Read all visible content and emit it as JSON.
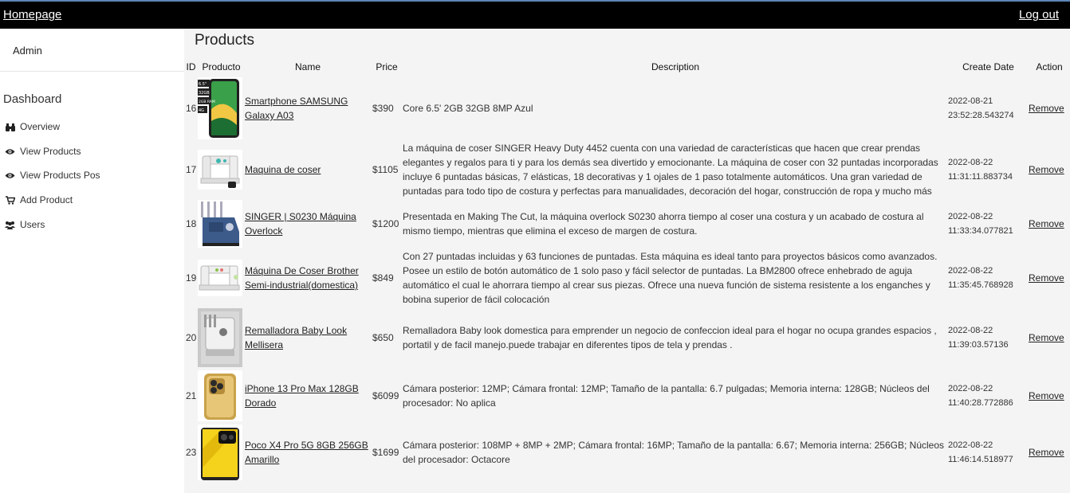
{
  "topbar": {
    "home": "Homepage",
    "logout": "Log out"
  },
  "sidebar": {
    "user": "Admin",
    "section": "Dashboard",
    "items": [
      {
        "label": "Overview",
        "icon": "binoculars-icon"
      },
      {
        "label": "View Products",
        "icon": "eye-icon"
      },
      {
        "label": "View Products Pos",
        "icon": "eye-icon"
      },
      {
        "label": "Add Product",
        "icon": "cart-icon"
      },
      {
        "label": "Users",
        "icon": "users-icon"
      }
    ]
  },
  "main": {
    "title": "Products",
    "columns": [
      "ID",
      "Producto",
      "Name",
      "Price",
      "Description",
      "Create Date",
      "Action"
    ],
    "rows": [
      {
        "id": "16",
        "name": "Smartphone SAMSUNG Galaxy A03",
        "price": "$390",
        "description": "Core 6.5' 2GB 32GB 8MP Azul",
        "date": "2022-08-21 23:52:28.543274",
        "action": "Remove",
        "image": "phone-samsung"
      },
      {
        "id": "17",
        "name": "Maquina de coser",
        "price": "$1105",
        "description": "La máquina de coser SINGER Heavy Duty 4452 cuenta con una variedad de características que hacen que crear prendas elegantes y regalos para ti y para los demás sea divertido y emocionante. La máquina de coser con 32 puntadas incorporadas incluye 6 puntadas básicas, 7 elásticas, 18 decorativas y 1 ojales de 1 paso totalmente automáticos. Una gran variedad de puntadas para todo tipo de costura y perfectas para manualidades, decoración del hogar, construcción de ropa y mucho más",
        "date": "2022-08-22 11:31:11.883734",
        "action": "Remove",
        "image": "sewing-machine"
      },
      {
        "id": "18",
        "name": "SINGER | S0230 Máquina Overlock",
        "price": "$1200",
        "description": "Presentada en Making The Cut, la máquina overlock S0230 ahorra tiempo al coser una costura y un acabado de costura al mismo tiempo, mientras que elimina el exceso de margen de costura.",
        "date": "2022-08-22 11:33:34.077821",
        "action": "Remove",
        "image": "overlock"
      },
      {
        "id": "19",
        "name": "Máquina De Coser Brother Semi-industrial(domestica)",
        "price": "$849",
        "description": "Con 27 puntadas incluidas y 63 funciones de puntadas. Esta máquina es ideal tanto para proyectos básicos como avanzados. Posee un estilo de botón automático de 1 solo paso y fácil selector de puntadas. La BM2800 ofrece enhebrado de aguja automático el cual le ahorrara tiempo al crear sus piezas. Ofrece una nueva función de sistema resistente a los enganches y bobina superior de fácil colocación",
        "date": "2022-08-22 11:35:45.768928",
        "action": "Remove",
        "image": "brother"
      },
      {
        "id": "20",
        "name": "Remalladora Baby Look Mellisera",
        "price": "$650",
        "description": "Remalladora Baby look domestica para emprender un negocio de confeccion ideal para el hogar no ocupa grandes espacios , portatil y de facil manejo.puede trabajar en diferentes tipos de tela y prendas .",
        "date": "2022-08-22 11:39:03.57136",
        "action": "Remove",
        "image": "remalladora"
      },
      {
        "id": "21",
        "name": "iPhone 13 Pro Max 128GB Dorado",
        "price": "$6099",
        "description": "Cámara posterior: 12MP; Cámara frontal: 12MP; Tamaño de la pantalla: 6.7 pulgadas; Memoria interna: 128GB; Núcleos del procesador: No aplica",
        "date": "2022-08-22 11:40:28.772886",
        "action": "Remove",
        "image": "iphone"
      },
      {
        "id": "23",
        "name": "Poco X4 Pro 5G 8GB 256GB Amarillo",
        "price": "$1699",
        "description": "Cámara posterior: 108MP + 8MP + 2MP; Cámara frontal: 16MP; Tamaño de la pantalla: 6.67; Memoria interna: 256GB; Núcleos del procesador: Octacore",
        "date": "2022-08-22 11:46:14.518977",
        "action": "Remove",
        "image": "poco"
      }
    ]
  },
  "samsung_badges": [
    "6.5\"",
    "32GB",
    "2GB RAM",
    "4G"
  ]
}
